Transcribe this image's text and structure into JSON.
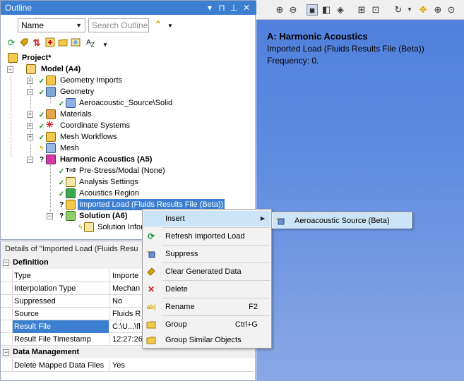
{
  "outline": {
    "title": "Outline",
    "title_buttons": [
      "▾",
      "⊣",
      "📌",
      "✕"
    ],
    "name_combo": "Name",
    "search_placeholder": "Search Outline"
  },
  "tree": {
    "project": "Project*",
    "model": "Model (A4)",
    "geometry_imports": "Geometry Imports",
    "geometry": "Geometry",
    "solid": "Aeroacoustic_Source\\Solid",
    "materials": "Materials",
    "coordinate_systems": "Coordinate Systems",
    "mesh_workflows": "Mesh Workflows",
    "mesh": "Mesh",
    "harmonic": "Harmonic Acoustics (A5)",
    "prestress": "Pre-Stress/Modal (None)",
    "analysis_settings": "Analysis Settings",
    "acoustics_region": "Acoustics Region",
    "imported_load": "Imported Load (Fluids Results File (Beta))",
    "solution": "Solution (A6)",
    "solution_info": "Solution Infor"
  },
  "details": {
    "title": "Details of \"Imported Load (Fluids Resu",
    "categories": {
      "definition": "Definition",
      "data_management": "Data Management"
    },
    "rows": [
      {
        "name": "Type",
        "value": "Importe"
      },
      {
        "name": "Interpolation Type",
        "value": "Mechan"
      },
      {
        "name": "Suppressed",
        "value": "No"
      },
      {
        "name": "Source",
        "value": "Fluids R"
      },
      {
        "name": "Result File",
        "value": "C:\\U...\\fl"
      },
      {
        "name": "Result File Timestamp",
        "value": "12:27:26"
      }
    ],
    "dm_rows": [
      {
        "name": "Delete Mapped Data Files",
        "value": "Yes"
      }
    ]
  },
  "graphics": {
    "heading": "A: Harmonic Acoustics",
    "line1": "Imported Load (Fluids Results File (Beta))",
    "line2": "Frequency: 0."
  },
  "context_menu": {
    "items": [
      {
        "label": "Insert",
        "shortcut": "",
        "icon": "insert-icon"
      },
      {
        "label": "Refresh Imported Load",
        "shortcut": "",
        "icon": "refresh-icon"
      },
      {
        "label": "Suppress",
        "shortcut": "",
        "icon": "suppress-icon"
      },
      {
        "label": "Clear Generated Data",
        "shortcut": "",
        "icon": "eraser-icon"
      },
      {
        "label": "Delete",
        "shortcut": "",
        "icon": "delete-icon"
      },
      {
        "label": "Rename",
        "shortcut": "F2",
        "icon": "rename-icon"
      },
      {
        "label": "Group",
        "shortcut": "Ctrl+G",
        "icon": "folder-icon"
      },
      {
        "label": "Group Similar Objects",
        "shortcut": "",
        "icon": "folder-icon"
      }
    ]
  },
  "submenu": {
    "items": [
      {
        "label": "Aeroacoustic Source (Beta)",
        "icon": "aeroacoustic-source-icon"
      }
    ]
  },
  "colors": {
    "title_bar": "#3c7fd1",
    "selection": "#3c7fd1",
    "menu_highlight": "#cce4f7",
    "graphics_top": "#4f7fdc",
    "graphics_bottom": "#8aa8e6"
  }
}
